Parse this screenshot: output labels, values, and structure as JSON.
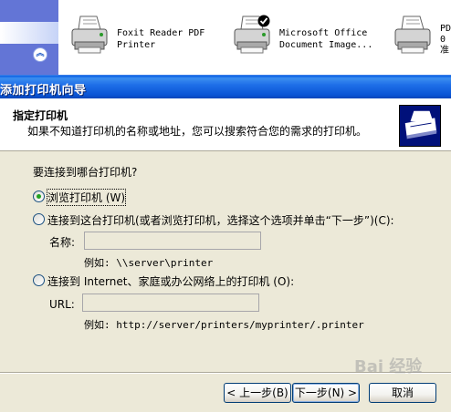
{
  "printers": [
    {
      "label": "Foxit Reader PDF\nPrinter",
      "icon": "printer-icon",
      "default": false
    },
    {
      "label": "Microsoft Office\nDocument Image...",
      "icon": "printer-icon",
      "default": true
    },
    {
      "label": "PD\n0\n准",
      "icon": "printer-icon",
      "default": false
    }
  ],
  "sidebar": {
    "collapse_icon": "chevron-up-double-icon"
  },
  "dialog": {
    "title": "添加打印机向导",
    "header_title": "指定打印机",
    "header_subtitle": "如果不知道打印机的名称或地址，您可以搜索符合您的需求的打印机。",
    "question": "要连接到哪台打印机?",
    "options": [
      {
        "label": "浏览打印机 (W)",
        "selected": true
      },
      {
        "label": "连接到这台打印机(或者浏览打印机，选择这个选项并单击“下一步”)(C):",
        "selected": false
      },
      {
        "label": "连接到 Internet、家庭或办公网络上的打印机 (O):",
        "selected": false
      }
    ],
    "name_label": "名称:",
    "name_value": "",
    "name_example": "例如: \\\\server\\printer",
    "url_label": "URL:",
    "url_value": "",
    "url_example": "例如: http://server/printers/myprinter/.printer",
    "buttons": {
      "back": "< 上一步(B)",
      "next": "下一步(N) >",
      "cancel": "取消"
    }
  },
  "watermark": "Bai 经验",
  "colors": {
    "title_bar": "#0a5fe5",
    "dialog_bg": "#ece9d8",
    "radio_dot": "#21a121"
  }
}
